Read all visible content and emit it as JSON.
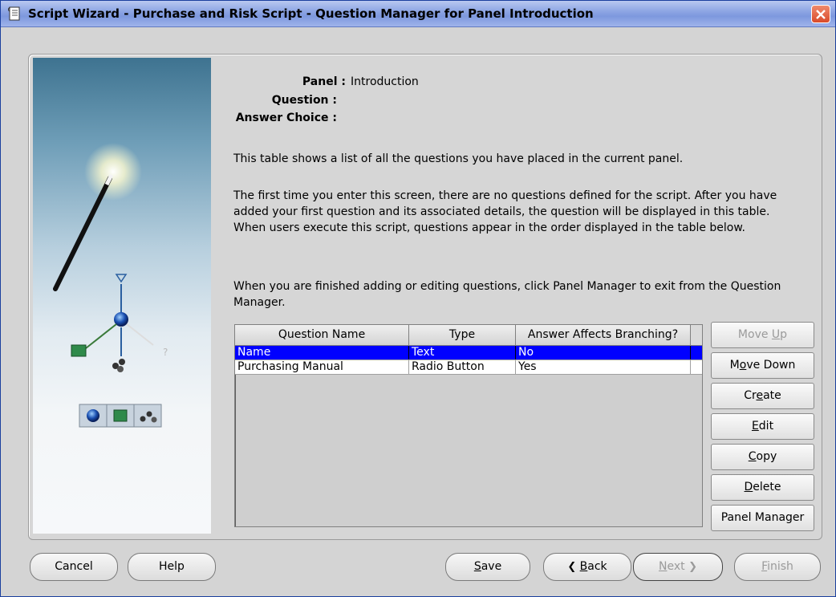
{
  "window": {
    "title": "Script Wizard - Purchase and Risk Script - Question Manager for Panel Introduction"
  },
  "info": {
    "panel_label": "Panel :",
    "panel_value": "Introduction",
    "question_label": "Question :",
    "question_value": "",
    "answer_choice_label": "Answer Choice :",
    "answer_choice_value": ""
  },
  "description": {
    "p1": "This table shows a list of all the questions you have placed in the current panel.",
    "p2": "The first time you enter this screen, there are no questions defined for the script. After you have added your first question and its associated details, the question will be displayed in this table.  When users execute this script, questions appear in the order displayed in the table below.",
    "p3": "When you are finished adding or editing questions, click Panel Manager to exit from the Question Manager."
  },
  "table": {
    "columns": [
      "Question Name",
      "Type",
      "Answer Affects Branching?"
    ],
    "rows": [
      [
        "Name",
        "Text",
        "No"
      ],
      [
        "Purchasing Manual",
        "Radio Button",
        "Yes"
      ]
    ],
    "selected_row": 0
  },
  "side_buttons": {
    "move_up": {
      "pre": "Move ",
      "u": "U",
      "post": "p"
    },
    "move_down": {
      "pre": "M",
      "u": "o",
      "post": "ve Down"
    },
    "create": {
      "pre": "Cr",
      "u": "e",
      "post": "ate"
    },
    "edit": {
      "pre": "",
      "u": "E",
      "post": "dit"
    },
    "copy": {
      "pre": "",
      "u": "C",
      "post": "opy"
    },
    "delete": {
      "pre": "",
      "u": "D",
      "post": "elete"
    },
    "panel_manager": {
      "pre": "Panel Manager",
      "u": "",
      "post": ""
    }
  },
  "bottom_buttons": {
    "cancel": {
      "pre": "Cancel",
      "u": "",
      "post": ""
    },
    "help": {
      "pre": "Help",
      "u": "",
      "post": ""
    },
    "save": {
      "pre": "",
      "u": "S",
      "post": "ave"
    },
    "back": {
      "pre": "",
      "u": "B",
      "post": "ack"
    },
    "next": {
      "pre": "",
      "u": "N",
      "post": "ext"
    },
    "finish": {
      "pre": "",
      "u": "F",
      "post": "inish"
    }
  },
  "icons": {
    "title": "document-icon",
    "close": "close-icon",
    "back": "chevron-left-icon",
    "next": "chevron-right-icon"
  },
  "colors": {
    "selection": "#0000ff",
    "titlebar": "#8ea6e4",
    "close": "#d94a2a"
  }
}
